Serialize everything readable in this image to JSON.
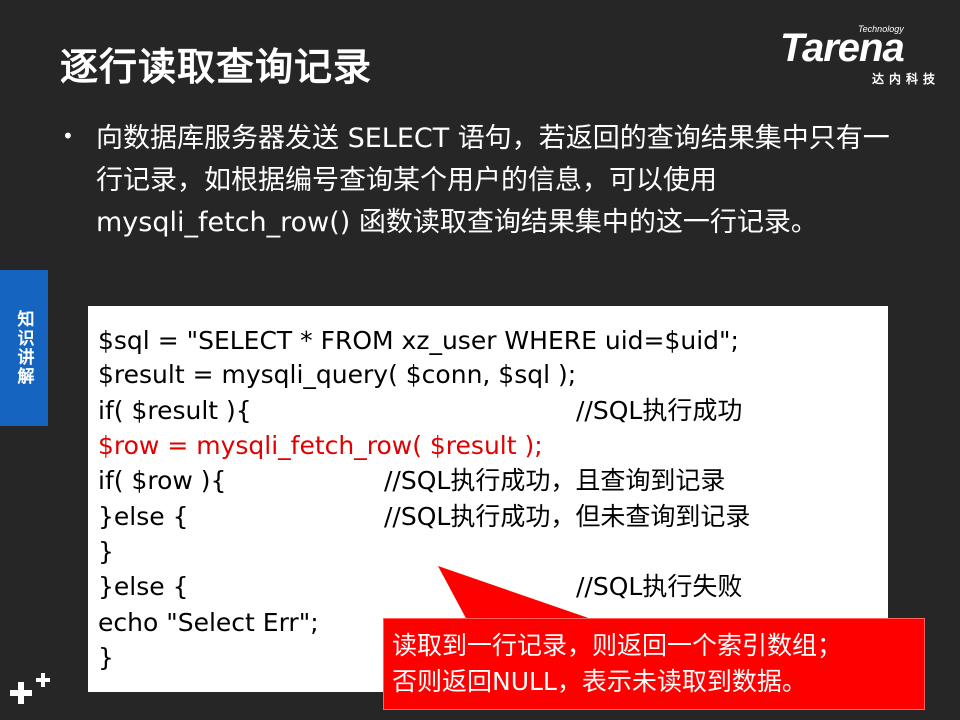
{
  "slide": {
    "title": "逐行读取查询记录"
  },
  "logo": {
    "small": "Technology",
    "main": "Tarena",
    "sub": "达内科技"
  },
  "side_tab": {
    "label": "知识讲解"
  },
  "bullet": {
    "marker": "•",
    "text": "向数据库服务器发送 SELECT 语句，若返回的查询结果集中只有一行记录，如根据编号查询某个用户的信息，可以使用 mysqli_fetch_row() 函数读取查询结果集中的这一行记录。"
  },
  "code": {
    "lines": [
      {
        "text": "$sql = \"SELECT * FROM xz_user WHERE uid=$uid\";",
        "comment": ""
      },
      {
        "text": "$result = mysqli_query( $conn, $sql );",
        "comment": ""
      },
      {
        "text": "if( $result ){",
        "comment": "//SQL执行成功"
      },
      {
        "text": "   $row = mysqli_fetch_row( $result );",
        "comment": ""
      },
      {
        "text": "   if( $row ){",
        "comment": "//SQL执行成功，且查询到记录"
      },
      {
        "text": "   }else {",
        "comment": "//SQL执行成功，但未查询到记录"
      },
      {
        "text": "   }",
        "comment": ""
      },
      {
        "text": "}else {",
        "comment": "//SQL执行失败"
      },
      {
        "text": "   echo \"Select Err\";",
        "comment": ""
      },
      {
        "text": "}",
        "comment": ""
      }
    ],
    "highlight_color": "#e00000"
  },
  "callout": {
    "line1": "读取到一行记录，则返回一个索引数组；",
    "line2": "否则返回NULL，表示未读取到数据。",
    "color": "#ff0000"
  },
  "colors": {
    "background": "#262626",
    "side_tab": "#1565c0"
  }
}
